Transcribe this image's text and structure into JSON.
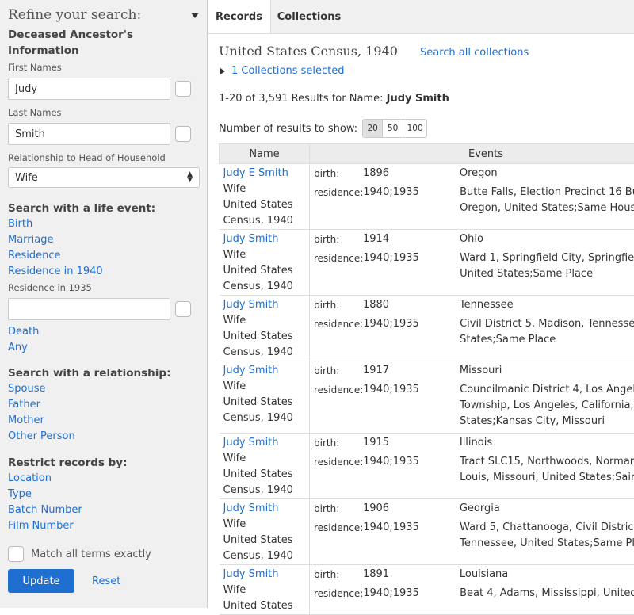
{
  "sidebar": {
    "title": "Refine your search:",
    "ancestor_title_1": "Deceased Ancestor's",
    "ancestor_title_2": "Information",
    "first_names_label": "First Names",
    "first_names_value": "Judy",
    "last_names_label": "Last Names",
    "last_names_value": "Smith",
    "relationship_label": "Relationship to Head of Household",
    "relationship_value": "Wife",
    "life_event_title": "Search with a life event:",
    "life_events": [
      "Birth",
      "Marriage",
      "Residence",
      "Residence in 1940"
    ],
    "residence1935_label": "Residence in 1935",
    "residence1935_value": "",
    "life_events_more": [
      "Death",
      "Any"
    ],
    "relationship_title": "Search with a relationship:",
    "relationships": [
      "Spouse",
      "Father",
      "Mother",
      "Other Person"
    ],
    "restrict_title": "Restrict records by:",
    "restrictions": [
      "Location",
      "Type",
      "Batch Number",
      "Film Number"
    ],
    "match_label": "Match all terms exactly",
    "update_label": "Update",
    "reset_label": "Reset"
  },
  "tabs": [
    "Records",
    "Collections"
  ],
  "collection_title": "United States Census, 1940",
  "search_all_label": "Search all collections",
  "collections_selected": "1 Collections selected",
  "results_prefix": "1-20 of 3,591 Results for Name:",
  "results_name": "Judy Smith",
  "num_results_label": "Number of results to show:",
  "page_sizes": [
    "20",
    "50",
    "100"
  ],
  "selected_page_size": "20",
  "table_headers": {
    "name": "Name",
    "events": "Events"
  },
  "rows": [
    {
      "name": "Judy E Smith",
      "relation": "Wife",
      "collection_1": "United States",
      "collection_2": "Census, 1940",
      "birth_label": "birth:",
      "birth_year": "1896",
      "birth_place": "Oregon",
      "res_label": "residence:",
      "res_year": "1940;1935",
      "res_place": [
        "Butte Falls, Election Precinct 16 Bu",
        "Oregon, United States;Same Hous"
      ]
    },
    {
      "name": "Judy Smith",
      "relation": "Wife",
      "collection_1": "United States",
      "collection_2": "Census, 1940",
      "birth_label": "birth:",
      "birth_year": "1914",
      "birth_place": "Ohio",
      "res_label": "residence:",
      "res_year": "1940;1935",
      "res_place": [
        "Ward 1, Springfield City, Springfie",
        "United States;Same Place"
      ]
    },
    {
      "name": "Judy Smith",
      "relation": "Wife",
      "collection_1": "United States",
      "collection_2": "Census, 1940",
      "birth_label": "birth:",
      "birth_year": "1880",
      "birth_place": "Tennessee",
      "res_label": "residence:",
      "res_year": "1940;1935",
      "res_place": [
        "Civil District 5, Madison, Tennesse",
        "States;Same Place"
      ]
    },
    {
      "name": "Judy Smith",
      "relation": "Wife",
      "collection_1": "United States",
      "collection_2": "Census, 1940",
      "birth_label": "birth:",
      "birth_year": "1917",
      "birth_place": "Missouri",
      "res_label": "residence:",
      "res_year": "1940;1935",
      "res_place": [
        "Councilmanic District 4, Los Angel",
        "Township, Los Angeles, California,",
        "States;Kansas City, Missouri"
      ]
    },
    {
      "name": "Judy Smith",
      "relation": "Wife",
      "collection_1": "United States",
      "collection_2": "Census, 1940",
      "birth_label": "birth:",
      "birth_year": "1915",
      "birth_place": "Illinois",
      "res_label": "residence:",
      "res_year": "1940;1935",
      "res_place": [
        "Tract SLC15, Northwoods, Normar",
        "Louis, Missouri, United States;Sair"
      ]
    },
    {
      "name": "Judy Smith",
      "relation": "Wife",
      "collection_1": "United States",
      "collection_2": "Census, 1940",
      "birth_label": "birth:",
      "birth_year": "1906",
      "birth_place": "Georgia",
      "res_label": "residence:",
      "res_year": "1940;1935",
      "res_place": [
        "Ward 5, Chattanooga, Civil Distric",
        "Tennessee, United States;Same Pl"
      ]
    },
    {
      "name": "Judy Smith",
      "relation": "Wife",
      "collection_1": "United States",
      "collection_2": "",
      "birth_label": "birth:",
      "birth_year": "1891",
      "birth_place": "Louisiana",
      "res_label": "residence:",
      "res_year": "1940;1935",
      "res_place": [
        "Beat 4, Adams, Mississippi, United"
      ]
    }
  ]
}
